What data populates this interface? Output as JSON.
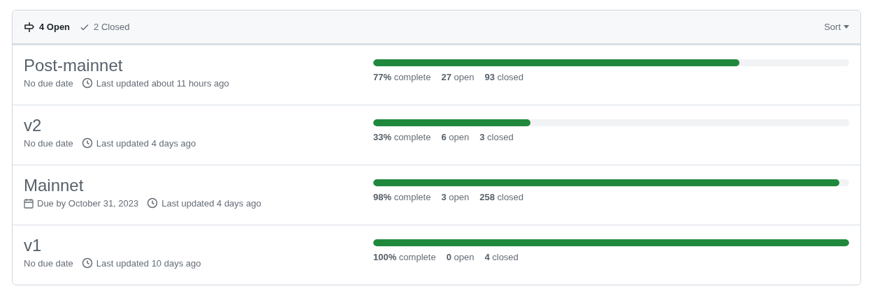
{
  "header": {
    "tabs": [
      {
        "label": "4 Open",
        "kind": "open",
        "selected": true
      },
      {
        "label": "2 Closed",
        "kind": "closed",
        "selected": false
      }
    ],
    "sort": {
      "label": "Sort"
    }
  },
  "milestones": [
    {
      "title": "Post-mainnet",
      "due": {
        "kind": "none",
        "text": "No due date"
      },
      "updated": "Last updated about 11 hours ago",
      "level": 0.77,
      "stats": [
        "**77%** complete",
        "**27** open",
        "**93** closed"
      ]
    },
    {
      "title": "v2",
      "due": {
        "kind": "none",
        "text": "No due date"
      },
      "updated": "Last updated 4 days ago",
      "level": 0.33,
      "stats": [
        "**33%** complete",
        "**6** open",
        "**3** closed"
      ]
    },
    {
      "title": "Mainnet",
      "due": {
        "kind": "date",
        "text": "Due by October 31, 2023"
      },
      "updated": "Last updated 4 days ago",
      "level": 0.98,
      "stats": [
        "**98%** complete",
        "**3** open",
        "**258** closed"
      ]
    },
    {
      "title": "v1",
      "due": {
        "kind": "none",
        "text": "No due date"
      },
      "updated": "Last updated 10 days ago",
      "level": 1,
      "stats": [
        "**100%** complete",
        "**0** open",
        "**4** closed"
      ]
    }
  ]
}
